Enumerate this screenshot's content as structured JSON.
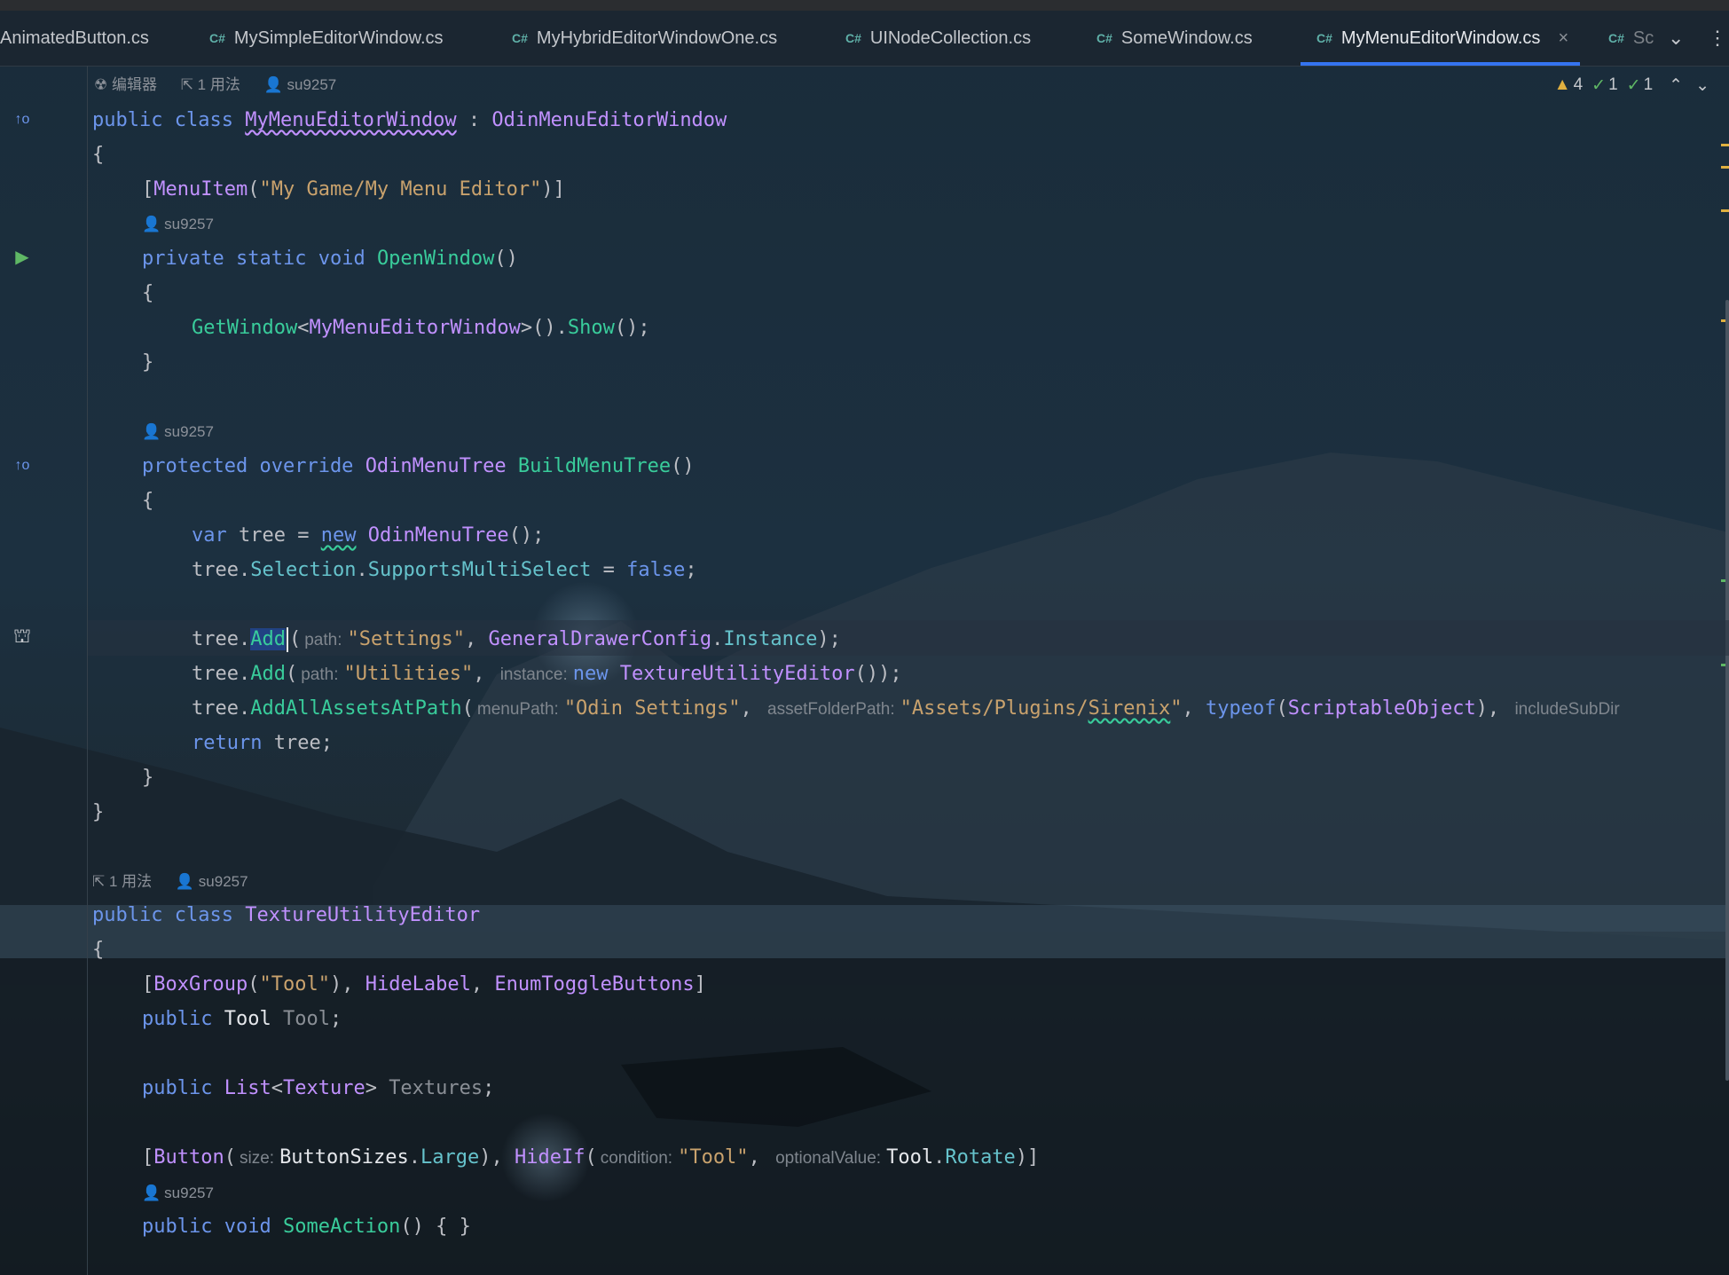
{
  "tabs": [
    {
      "label": "AnimatedButton.cs",
      "prefix": ""
    },
    {
      "label": "MySimpleEditorWindow.cs",
      "prefix": "C#"
    },
    {
      "label": "MyHybridEditorWindowOne.cs",
      "prefix": "C#"
    },
    {
      "label": "UINodeCollection.cs",
      "prefix": "C#"
    },
    {
      "label": "SomeWindow.cs",
      "prefix": "C#"
    },
    {
      "label": "MyMenuEditorWindow.cs",
      "prefix": "C#",
      "active": true,
      "close": "×"
    },
    {
      "label": "Sc",
      "prefix": "C#"
    }
  ],
  "tab_controls": {
    "more_label": "⌄",
    "menu_label": "⋮"
  },
  "inspections": {
    "warnings": "4",
    "checks": "1",
    "checks2": "1"
  },
  "meta": {
    "m1_editor": "编辑器",
    "m1_usage": "1 用法",
    "m1_author": "su9257",
    "m2_author": "su9257",
    "m3_author": "su9257",
    "m4_usage": "1 用法",
    "m4_author": "su9257",
    "m5_author": "su9257"
  },
  "code": {
    "public": "public",
    "class": "class",
    "private": "private",
    "static": "static",
    "void": "void",
    "protected": "protected",
    "override": "override",
    "var": "var",
    "new": "new",
    "false": "false",
    "return": "return",
    "typeof": "typeof",
    "class1": "MyMenuEditorWindow",
    "base1": "OdinMenuEditorWindow",
    "menuitem_attr": "MenuItem",
    "menuitem_arg": "\"My Game/My Menu Editor\"",
    "open_window": "OpenWindow",
    "get_window": "GetWindow",
    "show": "Show",
    "odin_menu_tree": "OdinMenuTree",
    "build_menu_tree": "BuildMenuTree",
    "tree": "tree",
    "selection": "Selection",
    "supports_multi": "SupportsMultiSelect",
    "add": "Add",
    "hint_path": "path:",
    "str_settings": "\"Settings\"",
    "general_drawer_config": "GeneralDrawerConfig",
    "instance": "Instance",
    "str_utilities": "\"Utilities\"",
    "hint_instance": "instance:",
    "texture_utility_editor": "TextureUtilityEditor",
    "add_all_assets": "AddAllAssetsAtPath",
    "hint_menupath": "menuPath:",
    "str_odin_settings": "\"Odin Settings\"",
    "hint_assetfolder": "assetFolderPath:",
    "str_assets_a": "\"Assets/Plugins/",
    "str_assets_b": "Sirenix",
    "str_assets_c": "\"",
    "scriptable_object": "ScriptableObject",
    "hint_include": "includeSubDir",
    "box_group": "BoxGroup",
    "str_tool": "\"Tool\"",
    "hide_label": "HideLabel",
    "enum_toggle": "EnumToggleButtons",
    "tool_type": "Tool",
    "tool_field": "Tool",
    "list": "List",
    "texture": "Texture",
    "textures_field": "Textures",
    "button_attr": "Button",
    "hint_size": "size:",
    "button_sizes": "ButtonSizes",
    "large": "Large",
    "hide_if": "HideIf",
    "hint_condition": "condition:",
    "hint_optional": "optionalValue:",
    "tool_ref": "Tool",
    "rotate": "Rotate",
    "some_action": "SomeAction"
  },
  "colors": {
    "keyword": "#6c95eb",
    "class": "#c191ff",
    "method": "#39cc9b",
    "string": "#c9a26d",
    "property": "#66c3cc",
    "accent": "#3574f0"
  }
}
